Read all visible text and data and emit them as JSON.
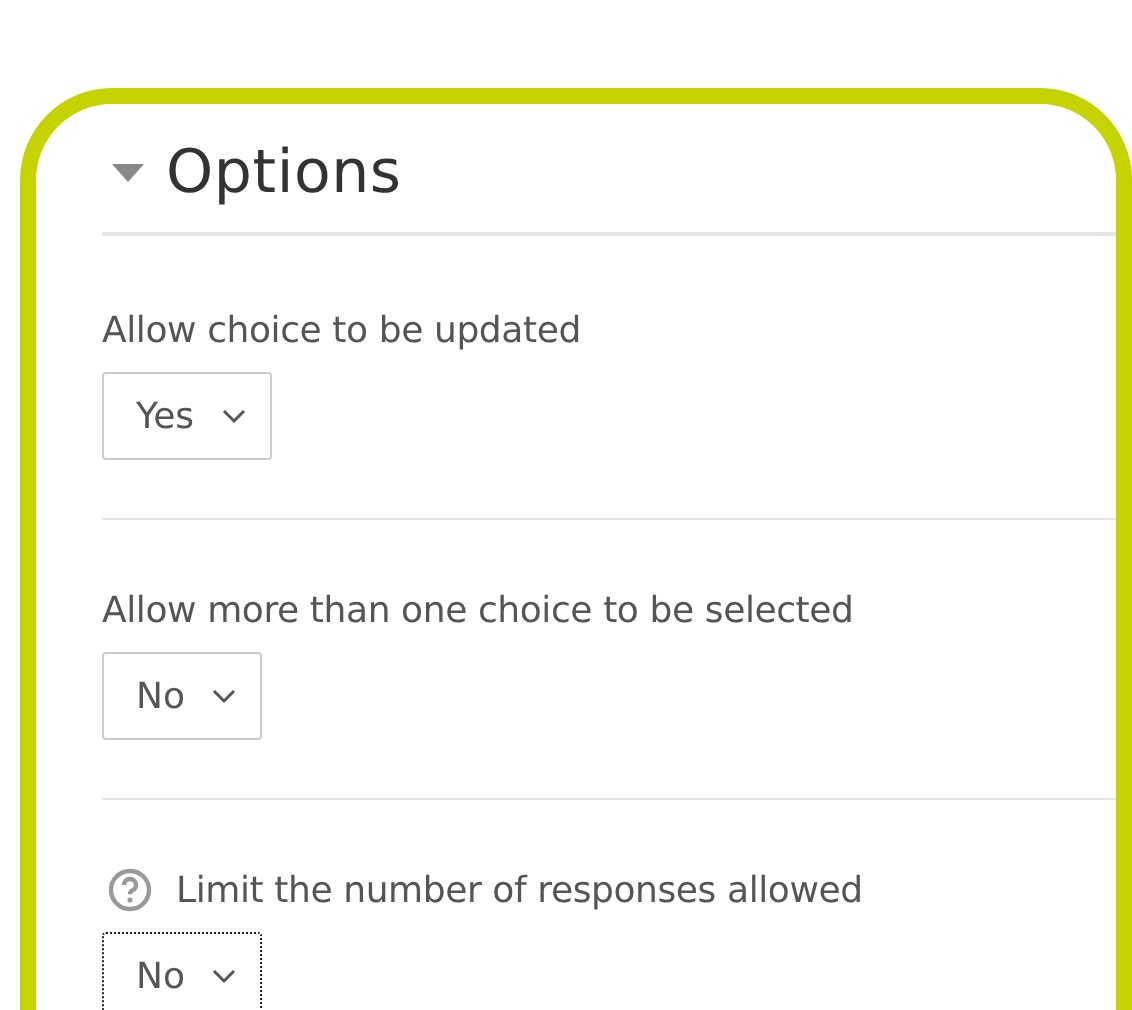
{
  "section": {
    "title": "Options",
    "expanded": true
  },
  "fields": [
    {
      "label": "Allow choice to be updated",
      "value": "Yes",
      "help": false,
      "focused": false
    },
    {
      "label": "Allow more than one choice to be selected",
      "value": "No",
      "help": false,
      "focused": false
    },
    {
      "label": "Limit the number of responses allowed",
      "value": "No",
      "help": true,
      "focused": true
    }
  ]
}
